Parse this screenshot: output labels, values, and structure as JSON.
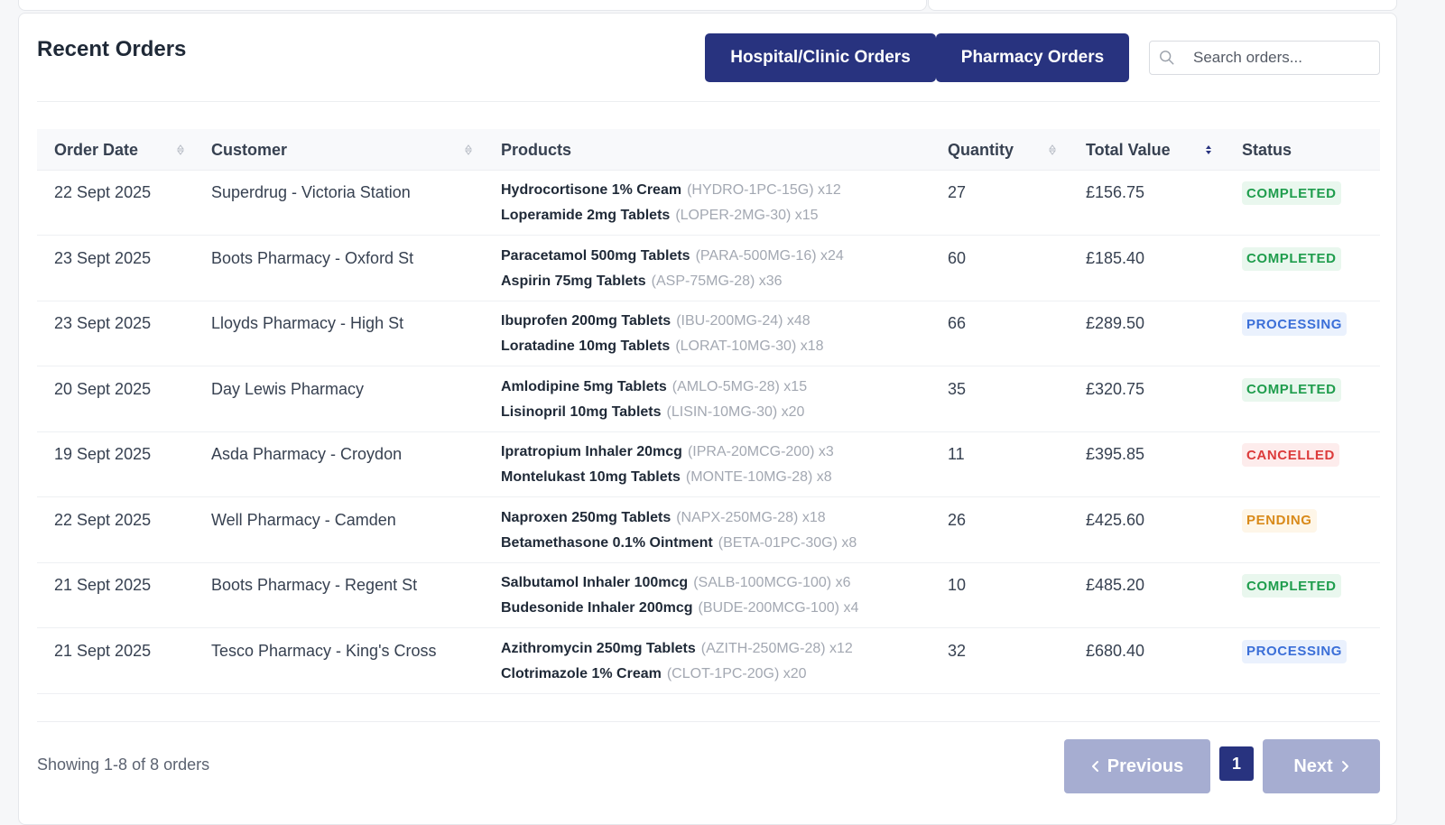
{
  "section": {
    "title": "Recent Orders"
  },
  "tabs": {
    "hospital_label": "Hospital/Clinic Orders",
    "pharmacy_label": "Pharmacy Orders"
  },
  "search": {
    "placeholder": "Search orders..."
  },
  "table": {
    "headers": {
      "order_date": "Order Date",
      "customer": "Customer",
      "products": "Products",
      "quantity": "Quantity",
      "total_value": "Total Value",
      "status": "Status"
    },
    "rows": [
      {
        "date": "22 Sept 2025",
        "customer": "Superdrug - Victoria Station",
        "products": [
          {
            "name": "Hydrocortisone 1% Cream",
            "sku": "(HYDRO-1PC-15G) x12"
          },
          {
            "name": "Loperamide 2mg Tablets",
            "sku": "(LOPER-2MG-30) x15"
          }
        ],
        "quantity": "27",
        "total": "£156.75",
        "status": "COMPLETED",
        "status_kind": "completed"
      },
      {
        "date": "23 Sept 2025",
        "customer": "Boots Pharmacy - Oxford St",
        "products": [
          {
            "name": "Paracetamol 500mg Tablets",
            "sku": "(PARA-500MG-16) x24"
          },
          {
            "name": "Aspirin 75mg Tablets",
            "sku": "(ASP-75MG-28) x36"
          }
        ],
        "quantity": "60",
        "total": "£185.40",
        "status": "COMPLETED",
        "status_kind": "completed"
      },
      {
        "date": "23 Sept 2025",
        "customer": "Lloyds Pharmacy - High St",
        "products": [
          {
            "name": "Ibuprofen 200mg Tablets",
            "sku": "(IBU-200MG-24) x48"
          },
          {
            "name": "Loratadine 10mg Tablets",
            "sku": "(LORAT-10MG-30) x18"
          }
        ],
        "quantity": "66",
        "total": "£289.50",
        "status": "PROCESSING",
        "status_kind": "processing"
      },
      {
        "date": "20 Sept 2025",
        "customer": "Day Lewis Pharmacy",
        "products": [
          {
            "name": "Amlodipine 5mg Tablets",
            "sku": "(AMLO-5MG-28) x15"
          },
          {
            "name": "Lisinopril 10mg Tablets",
            "sku": "(LISIN-10MG-30) x20"
          }
        ],
        "quantity": "35",
        "total": "£320.75",
        "status": "COMPLETED",
        "status_kind": "completed"
      },
      {
        "date": "19 Sept 2025",
        "customer": "Asda Pharmacy - Croydon",
        "products": [
          {
            "name": "Ipratropium Inhaler 20mcg",
            "sku": "(IPRA-20MCG-200) x3"
          },
          {
            "name": "Montelukast 10mg Tablets",
            "sku": "(MONTE-10MG-28) x8"
          }
        ],
        "quantity": "11",
        "total": "£395.85",
        "status": "CANCELLED",
        "status_kind": "cancelled"
      },
      {
        "date": "22 Sept 2025",
        "customer": "Well Pharmacy - Camden",
        "products": [
          {
            "name": "Naproxen 250mg Tablets",
            "sku": "(NAPX-250MG-28) x18"
          },
          {
            "name": "Betamethasone 0.1% Ointment",
            "sku": "(BETA-01PC-30G) x8"
          }
        ],
        "quantity": "26",
        "total": "£425.60",
        "status": "PENDING",
        "status_kind": "pending"
      },
      {
        "date": "21 Sept 2025",
        "customer": "Boots Pharmacy - Regent St",
        "products": [
          {
            "name": "Salbutamol Inhaler 100mcg",
            "sku": "(SALB-100MCG-100) x6"
          },
          {
            "name": "Budesonide Inhaler 200mcg",
            "sku": "(BUDE-200MCG-100) x4"
          }
        ],
        "quantity": "10",
        "total": "£485.20",
        "status": "COMPLETED",
        "status_kind": "completed"
      },
      {
        "date": "21 Sept 2025",
        "customer": "Tesco Pharmacy - King's Cross",
        "products": [
          {
            "name": "Azithromycin 250mg Tablets",
            "sku": "(AZITH-250MG-28) x12"
          },
          {
            "name": "Clotrimazole 1% Cream",
            "sku": "(CLOT-1PC-20G) x20"
          }
        ],
        "quantity": "32",
        "total": "£680.40",
        "status": "PROCESSING",
        "status_kind": "processing"
      }
    ]
  },
  "pagination": {
    "summary": "Showing 1-8 of 8 orders",
    "previous_label": "Previous",
    "next_label": "Next",
    "current_page": "1"
  },
  "icons": {
    "search": "search-icon",
    "sort": "sort-icon",
    "prev": "chevron-left-icon",
    "next": "chevron-right-icon"
  },
  "colors": {
    "primary": "#28337f",
    "primary_disabled": "#a6add1",
    "completed": "#1f9d4d",
    "processing": "#3b6fd8",
    "cancelled": "#dc3b3b",
    "pending": "#d98a1a"
  }
}
